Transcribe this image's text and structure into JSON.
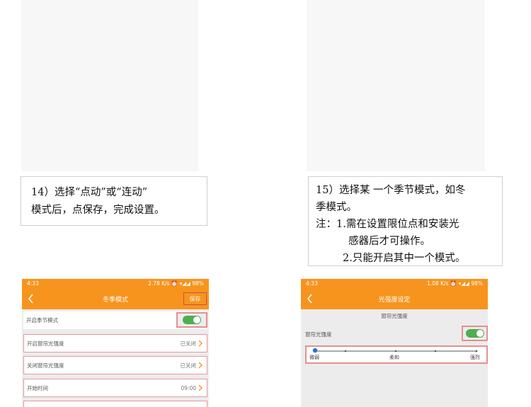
{
  "step14": {
    "line1": "14）选择“点动”或“连动”",
    "line2": "模式后，点保存，完成设置。"
  },
  "step15": {
    "line1": "15）选择某 一个季节模式，如冬",
    "line2": "季模式。",
    "line3": "注：1.需在设置限位点和安装光",
    "line4": "感器后才可操作。",
    "line5": "2.只能开启其中一个模式。"
  },
  "phone_left": {
    "status_time": "4:33",
    "status_right": "2.78 K/s ⏰ ▾◢◢ 98%",
    "title": "冬季模式",
    "save_label": "保存",
    "rows": {
      "season_toggle": "开启季节模式",
      "open_light": "开启窗帘光强度",
      "open_light_value": "已关闭",
      "close_light": "关闭窗帘光强度",
      "close_light_value": "已关闭",
      "start_time": "开始时间",
      "start_time_value": "09:00"
    },
    "season_toggle_on": true
  },
  "phone_right": {
    "status_time": "4:33",
    "status_right": "1.08 K/s ⏰ ▾◢◢ 98%",
    "title": "光强度设定",
    "section_header": "窗帘光强度",
    "row_label": "窗帘光强度",
    "toggle_on": true,
    "slider": {
      "labels": [
        "微弱",
        "柔和",
        "强烈"
      ],
      "selected_index": 0
    }
  },
  "colors": {
    "accent": "#f7941d",
    "toggle_on": "#4caf50",
    "highlight": "#e59090",
    "slider": "#2b6fd6"
  }
}
